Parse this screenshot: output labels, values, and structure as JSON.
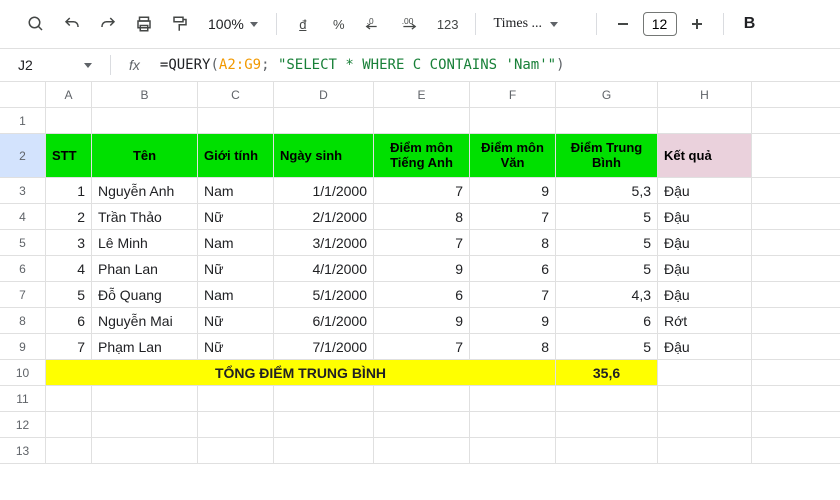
{
  "toolbar": {
    "zoom": "100%",
    "currency": "đ",
    "percent": "%",
    "number": "123",
    "font": "Times ...",
    "size": "12",
    "bold": "B"
  },
  "formula": {
    "cell": "J2",
    "fx": "fx",
    "eq": "=",
    "fn": "QUERY",
    "open": "(",
    "range": "A2:G9",
    "semi": "; ",
    "str": "\"SELECT * WHERE C CONTAINS 'Nam'\"",
    "close": ")"
  },
  "cols": {
    "a": "A",
    "b": "B",
    "c": "C",
    "d": "D",
    "e": "E",
    "f": "F",
    "g": "G",
    "h": "H"
  },
  "rowNums": {
    "r1": "1",
    "r2": "2",
    "r3": "3",
    "r4": "4",
    "r5": "5",
    "r6": "6",
    "r7": "7",
    "r8": "8",
    "r9": "9",
    "r10": "10",
    "r11": "11",
    "r12": "12",
    "r13": "13"
  },
  "chart_data": {
    "type": "table",
    "headers": {
      "stt": "STT",
      "ten": "Tên",
      "gioitinh": "Giới tính",
      "ngaysinh": "Ngày sinh",
      "diemanh": "Điểm môn Tiếng Anh",
      "diemvan": "Điểm môn Văn",
      "diemtb": "Điểm Trung Bình",
      "ketqua": "Kết quả"
    },
    "rows": [
      {
        "stt": "1",
        "ten": "Nguyễn Anh",
        "gioitinh": "Nam",
        "ngaysinh": "1/1/2000",
        "diemanh": "7",
        "diemvan": "9",
        "diemtb": "5,3",
        "ketqua": "Đậu"
      },
      {
        "stt": "2",
        "ten": "Trần Thảo",
        "gioitinh": "Nữ",
        "ngaysinh": "2/1/2000",
        "diemanh": "8",
        "diemvan": "7",
        "diemtb": "5",
        "ketqua": "Đậu"
      },
      {
        "stt": "3",
        "ten": "Lê Minh",
        "gioitinh": "Nam",
        "ngaysinh": "3/1/2000",
        "diemanh": "7",
        "diemvan": "8",
        "diemtb": "5",
        "ketqua": "Đậu"
      },
      {
        "stt": "4",
        "ten": "Phan Lan",
        "gioitinh": "Nữ",
        "ngaysinh": "4/1/2000",
        "diemanh": "9",
        "diemvan": "6",
        "diemtb": "5",
        "ketqua": "Đậu"
      },
      {
        "stt": "5",
        "ten": "Đỗ Quang",
        "gioitinh": "Nam",
        "ngaysinh": "5/1/2000",
        "diemanh": "6",
        "diemvan": "7",
        "diemtb": "4,3",
        "ketqua": "Đậu"
      },
      {
        "stt": "6",
        "ten": "Nguyễn Mai",
        "gioitinh": "Nữ",
        "ngaysinh": "6/1/2000",
        "diemanh": "9",
        "diemvan": "9",
        "diemtb": "6",
        "ketqua": "Rớt"
      },
      {
        "stt": "7",
        "ten": "Phạm Lan",
        "gioitinh": "Nữ",
        "ngaysinh": "7/1/2000",
        "diemanh": "7",
        "diemvan": "8",
        "diemtb": "5",
        "ketqua": "Đậu"
      }
    ],
    "total": {
      "label": "TỔNG ĐIỂM TRUNG BÌNH",
      "value": "35,6"
    }
  }
}
